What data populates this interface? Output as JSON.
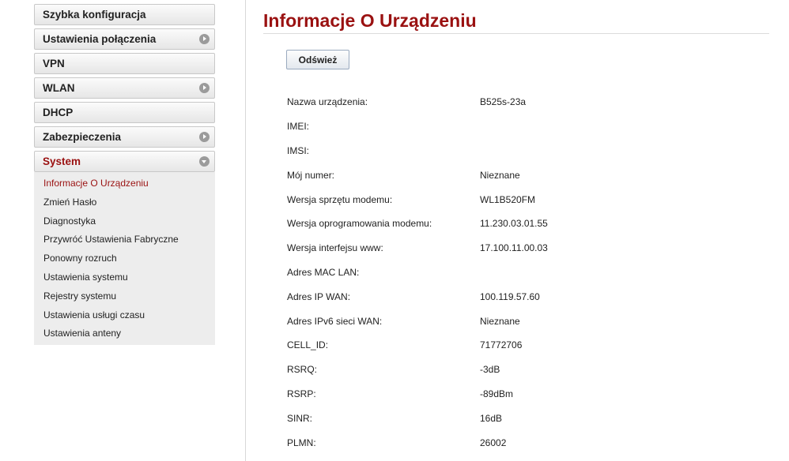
{
  "sidebar": {
    "items": [
      {
        "label": "Szybka konfiguracja",
        "arrow": "none"
      },
      {
        "label": "Ustawienia połączenia",
        "arrow": "right"
      },
      {
        "label": "VPN",
        "arrow": "none"
      },
      {
        "label": "WLAN",
        "arrow": "right"
      },
      {
        "label": "DHCP",
        "arrow": "none"
      },
      {
        "label": "Zabezpieczenia",
        "arrow": "right"
      },
      {
        "label": "System",
        "arrow": "down"
      }
    ],
    "submenu": [
      "Informacje O Urządzeniu",
      "Zmień Hasło",
      "Diagnostyka",
      "Przywróć Ustawienia Fabryczne",
      "Ponowny rozruch",
      "Ustawienia systemu",
      "Rejestry systemu",
      "Ustawienia usługi czasu",
      "Ustawienia anteny"
    ]
  },
  "main": {
    "title": "Informacje O Urządzeniu",
    "refresh_label": "Odśwież",
    "info": [
      {
        "label": "Nazwa urządzenia:",
        "value": "B525s-23a"
      },
      {
        "label": "IMEI:",
        "value": ""
      },
      {
        "label": "IMSI:",
        "value": ""
      },
      {
        "label": "Mój numer:",
        "value": "Nieznane"
      },
      {
        "label": "Wersja sprzętu modemu:",
        "value": "WL1B520FM"
      },
      {
        "label": "Wersja oprogramowania modemu:",
        "value": "11.230.03.01.55"
      },
      {
        "label": "Wersja interfejsu www:",
        "value": "17.100.11.00.03"
      },
      {
        "label": "Adres MAC LAN:",
        "value": ""
      },
      {
        "label": "Adres IP WAN:",
        "value": "100.119.57.60"
      },
      {
        "label": "Adres IPv6 sieci WAN:",
        "value": "Nieznane"
      },
      {
        "label": "CELL_ID:",
        "value": "71772706"
      },
      {
        "label": "RSRQ:",
        "value": "-3dB"
      },
      {
        "label": "RSRP:",
        "value": "-89dBm"
      },
      {
        "label": "SINR:",
        "value": "16dB"
      },
      {
        "label": "PLMN:",
        "value": "26002"
      }
    ]
  },
  "colors": {
    "accent": "#9a1111",
    "submenu_bg": "#ededed",
    "button_border": "#9aaabf"
  }
}
